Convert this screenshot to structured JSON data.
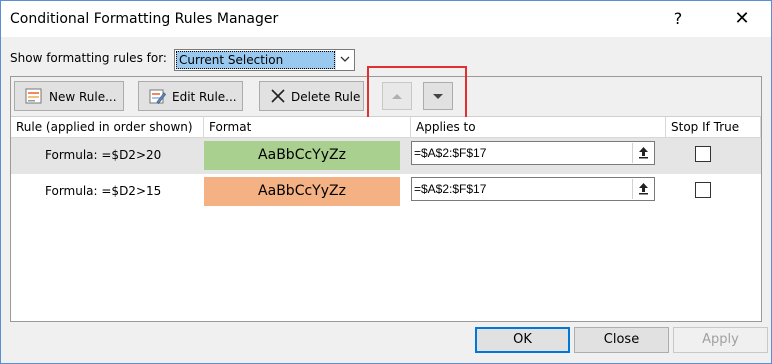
{
  "window": {
    "title": "Conditional Formatting Rules Manager",
    "help_glyph": "?",
    "close_glyph": "✕"
  },
  "scope": {
    "label": "Show formatting rules for:",
    "selected": "Current Selection"
  },
  "toolbar": {
    "new_rule": "New Rule...",
    "edit_rule": "Edit Rule...",
    "delete_rule": "Delete Rule",
    "move_up_icon": "triangle-up-icon",
    "move_down_icon": "triangle-down-icon"
  },
  "table": {
    "headers": [
      "Rule (applied in order shown)",
      "Format",
      "Applies to",
      "Stop If True"
    ],
    "rows": [
      {
        "rule": "Formula: =$D2>20",
        "preview": "AaBbCcYyZz",
        "preview_color": "#a9d08e",
        "applies_to": "=$A$2:$F$17",
        "stop_if_true": false
      },
      {
        "rule": "Formula: =$D2>15",
        "preview": "AaBbCcYyZz",
        "preview_color": "#f4b183",
        "applies_to": "=$A$2:$F$17",
        "stop_if_true": false
      }
    ]
  },
  "buttons": {
    "ok": "OK",
    "close": "Close",
    "apply": "Apply"
  },
  "colors": {
    "highlight": "#e03030",
    "select_bg": "#99c9ef"
  }
}
